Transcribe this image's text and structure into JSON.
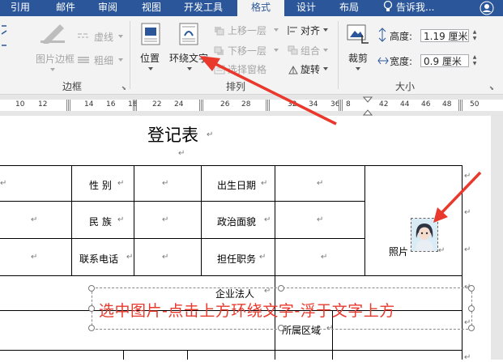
{
  "tabs": [
    "引用",
    "邮件",
    "审阅",
    "视图",
    "开发工具",
    "格式",
    "设计",
    "布局"
  ],
  "tell_me": "告诉我...",
  "ribbon": {
    "border_group": {
      "picture_border": "图片边框",
      "dashes": "虚线",
      "weight": "粗细",
      "label": "边框"
    },
    "arrange_group": {
      "position": "位置",
      "wrap_text": "环绕文字",
      "bring_forward": "上移一层",
      "send_backward": "下移一层",
      "selection_pane": "选择窗格",
      "align": "对齐",
      "group": "组合",
      "rotate": "旋转",
      "label": "排列"
    },
    "size_group": {
      "crop": "裁剪",
      "height_label": "高度:",
      "height_value": "1.19 厘米",
      "width_label": "宽度:",
      "width_value": "0.9 厘米",
      "label": "大小"
    }
  },
  "ruler": [
    "10",
    "12",
    "14",
    "16",
    "18",
    "22",
    "24",
    "26",
    "28",
    "32",
    "34",
    "36",
    "8",
    "42",
    "44",
    "46",
    "48",
    "50"
  ],
  "document": {
    "title": "登记表",
    "gender": "性 别",
    "birth_date": "出生日期",
    "ethnicity": "民 族",
    "political_status": "政治面貌",
    "photo": "照片",
    "phone": "联系电话",
    "position": "担任职务",
    "legal_rep": "企业法人",
    "region": "所属区域"
  },
  "annotation": "选中图片-点击上方环绕文字-浮于文字上方",
  "colors": {
    "ribbon_tab_bar": "#2b579a",
    "annotation_red": "#e8392c"
  }
}
